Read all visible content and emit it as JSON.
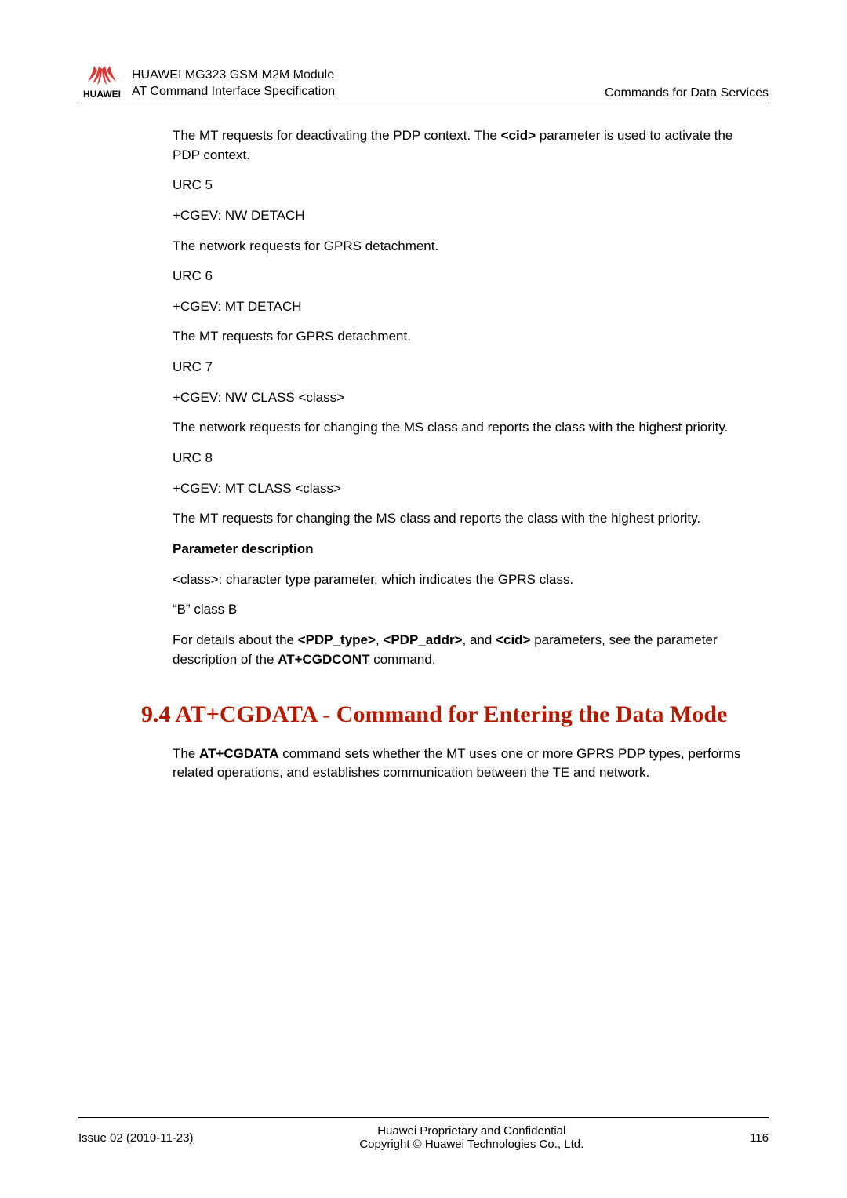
{
  "header": {
    "brand": "HUAWEI",
    "title1": "HUAWEI MG323 GSM M2M Module",
    "title2": "AT Command Interface Specification",
    "right": "Commands for Data Services"
  },
  "body": {
    "p1_a": "The MT requests for deactivating the PDP context. The ",
    "p1_bold": "<cid>",
    "p1_b": " parameter is used to activate the PDP context.",
    "urc5": "URC 5",
    "cgev5": "+CGEV: NW DETACH",
    "desc5": "The network requests for GPRS detachment.",
    "urc6": "URC 6",
    "cgev6": "+CGEV: MT DETACH",
    "desc6": "The MT requests for GPRS detachment.",
    "urc7": "URC 7",
    "cgev7": "+CGEV: NW CLASS <class>",
    "desc7": "The network requests for changing the MS class and reports the class with the highest priority.",
    "urc8": "URC 8",
    "cgev8": "+CGEV: MT CLASS <class>",
    "desc8": "The MT requests for changing the MS class and reports the class with the highest priority.",
    "param_heading": "Parameter description",
    "classdesc": "<class>: character type parameter, which indicates the GPRS class.",
    "classB": "“B”  class B",
    "details_a": "For details about the ",
    "pdp_type": "<PDP_type>",
    "comma1": ", ",
    "pdp_addr": "<PDP_addr>",
    "and": ", and ",
    "cid": "<cid>",
    "details_b": " parameters, see the parameter description of the ",
    "cgdcont": "AT+CGDCONT",
    "details_c": " command."
  },
  "section": {
    "heading": "9.4 AT+CGDATA - Command for Entering the Data Mode",
    "intro_a": "The ",
    "intro_bold": "AT+CGDATA",
    "intro_b": " command sets whether the MT uses one or more GPRS PDP types, performs related operations, and establishes communication between the TE and network."
  },
  "footer": {
    "left": "Issue 02 (2010-11-23)",
    "center1": "Huawei Proprietary and Confidential",
    "center2": "Copyright © Huawei Technologies Co., Ltd.",
    "right": "116"
  }
}
